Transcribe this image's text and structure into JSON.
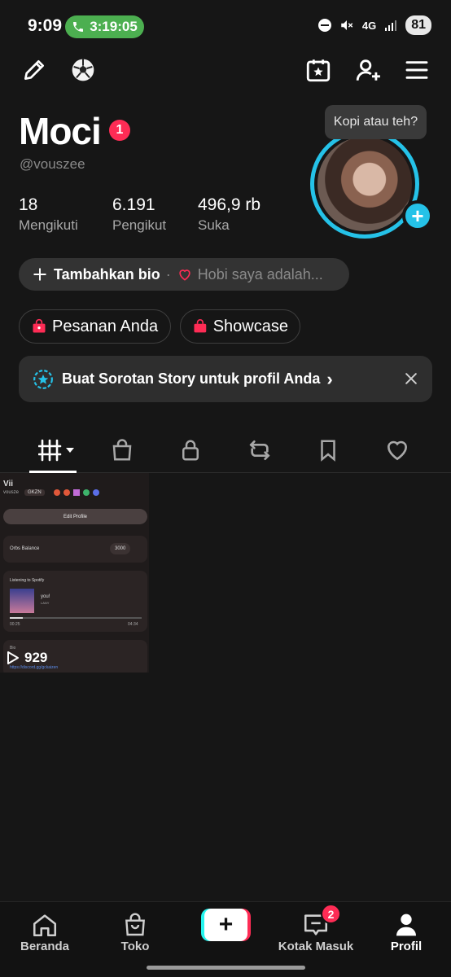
{
  "status": {
    "time": "9:09",
    "call_timer": "3:19:05",
    "network": "4G",
    "battery": "81"
  },
  "toolbar": {
    "icons": [
      "edit-pencil-icon",
      "soccer-ball-icon",
      "calendar-star-icon",
      "add-friend-icon",
      "menu-icon"
    ]
  },
  "profile": {
    "name": "Moci",
    "name_badge": "1",
    "handle": "@vouszee",
    "stats": [
      {
        "value": "18",
        "label": "Mengikuti"
      },
      {
        "value": "6.191",
        "label": "Pengikut"
      },
      {
        "value": "496,9 rb",
        "label": "Suka"
      }
    ],
    "avatar_bubble": "Kopi atau teh?"
  },
  "bio": {
    "add_label": "Tambahkan bio",
    "separator": "·",
    "hobby_placeholder": "Hobi saya adalah..."
  },
  "chips": [
    {
      "label": "Pesanan Anda"
    },
    {
      "label": "Showcase"
    }
  ],
  "banner": {
    "text": "Buat Sorotan Story untuk profil Anda",
    "arrow": "›"
  },
  "tabs": [
    "videos-grid-icon",
    "shop-bag-icon",
    "lock-icon",
    "repost-icon",
    "bookmark-icon",
    "heart-icon"
  ],
  "video": {
    "name": "Vii",
    "user": "vousze",
    "tag": "GKZN",
    "edit_profile": "Edit Profile",
    "orbs_label": "Orbs Balance",
    "orbs_value": "3000",
    "spotify_label": "Listening to Spotify",
    "song": "you!",
    "artist": "LANY",
    "time_start": "00:25",
    "time_end": "04:34",
    "bio_label": "Bio",
    "link": "https://discord.gg/gckaizen",
    "views": "929"
  },
  "bottom_nav": {
    "items": [
      {
        "label": "Beranda"
      },
      {
        "label": "Toko"
      },
      {
        "label": "Kotak Masuk"
      },
      {
        "label": "Profil"
      }
    ],
    "inbox_badge": "2"
  },
  "colors": {
    "accent_red": "#fe2c55",
    "accent_cyan": "#25c2e8",
    "background": "#161616"
  }
}
